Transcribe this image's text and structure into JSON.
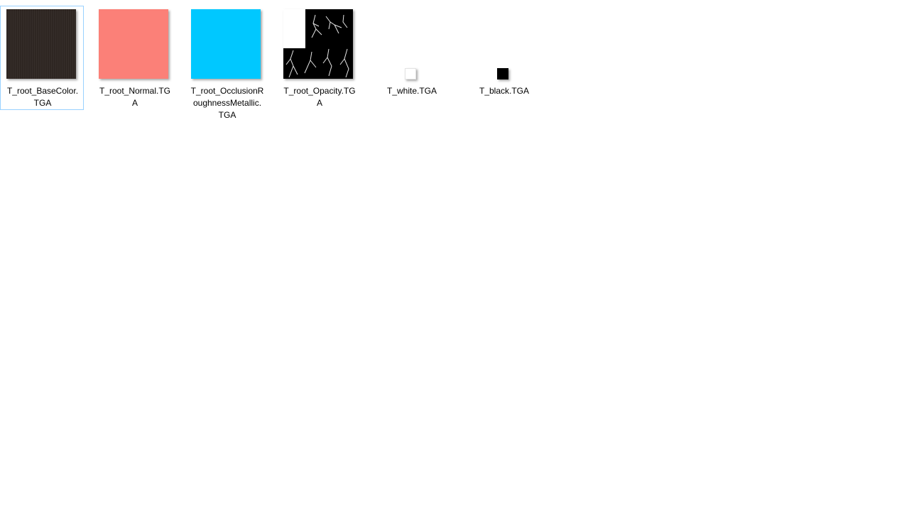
{
  "files": [
    {
      "name": "T_root_BaseColor.TGA",
      "label_line1": "T_root_BaseColor.",
      "label_line2": "TGA",
      "label_line3": "",
      "swatch_color": "#2e2622",
      "selected": true
    },
    {
      "name": "T_root_Normal.TGA",
      "label_line1": "T_root_Normal.TG",
      "label_line2": "A",
      "label_line3": "",
      "swatch_color": "#fb8078",
      "selected": false
    },
    {
      "name": "T_root_OcclusionRoughnessMetallic.TGA",
      "label_line1": "T_root_OcclusionR",
      "label_line2": "oughnessMetallic.",
      "label_line3": "TGA",
      "swatch_color": "#00c8ff",
      "selected": false
    },
    {
      "name": "T_root_Opacity.TGA",
      "label_line1": "T_root_Opacity.TG",
      "label_line2": "A",
      "label_line3": "",
      "swatch_color": "#000000",
      "selected": false
    },
    {
      "name": "T_white.TGA",
      "label_line1": "T_white.TGA",
      "label_line2": "",
      "label_line3": "",
      "swatch_color": "#ffffff",
      "selected": false
    },
    {
      "name": "T_black.TGA",
      "label_line1": "T_black.TGA",
      "label_line2": "",
      "label_line3": "",
      "swatch_color": "#000000",
      "selected": false
    }
  ],
  "selection_border_color": "#99d1ff"
}
